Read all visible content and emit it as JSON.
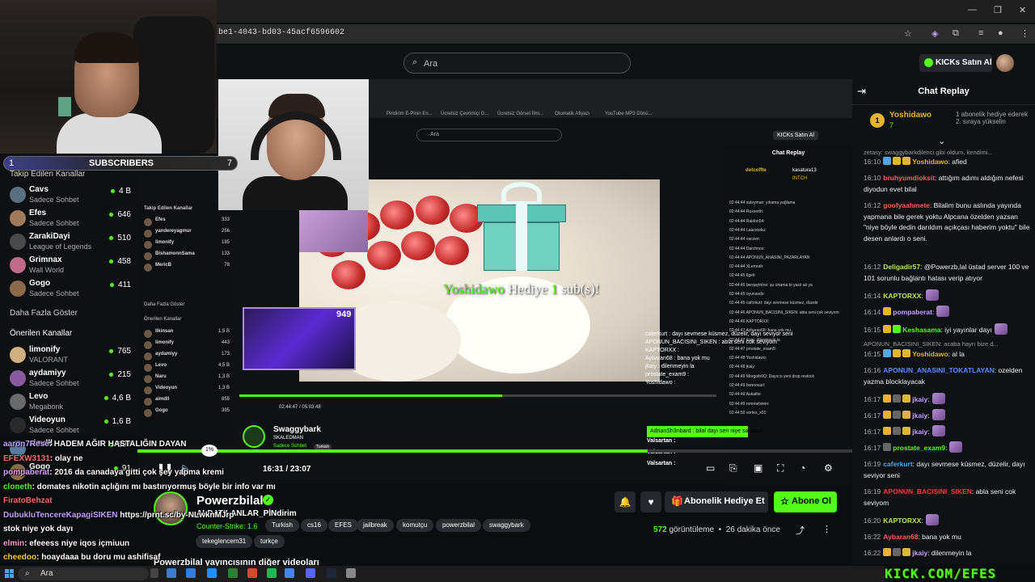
{
  "browser": {
    "url": "be1-4043-bd03-45acf6596602",
    "window_minimize": "—",
    "window_restore": "❐",
    "window_close": "✕"
  },
  "header": {
    "search_placeholder": "Ara",
    "kick_buy_label": "KICKs Satın Al"
  },
  "subs_bar": {
    "left": "1",
    "label": "SUBSCRIBERS",
    "right": "7"
  },
  "sidebar": {
    "followed_title": "Takip Edilen Kanallar",
    "followed": [
      {
        "name": "Cavs",
        "sub": "Sadece Sohbet",
        "count": "4 B",
        "color": "#5a6f80"
      },
      {
        "name": "Efes",
        "sub": "Sadece Sohbet",
        "count": "646",
        "color": "#a07a5a"
      },
      {
        "name": "ZarakiDayi",
        "sub": "League of Legends",
        "count": "510",
        "color": "#4a4a4a"
      },
      {
        "name": "Grimnax",
        "sub": "Wall World",
        "count": "458",
        "color": "#c06a8a"
      },
      {
        "name": "Gogo",
        "sub": "Sadece Sohbet",
        "count": "411",
        "color": "#8a6a4a"
      }
    ],
    "show_more": "Daha Fazla Göster",
    "recommended_title": "Önerilen Kanallar",
    "recommended": [
      {
        "name": "limonify",
        "sub": "VALORANT",
        "count": "765",
        "color": "#d0b080"
      },
      {
        "name": "aydamiyy",
        "sub": "Sadece Sohbet",
        "count": "215",
        "color": "#8a5aa0"
      },
      {
        "name": "Levo",
        "sub": "Megabonk",
        "count": "4,6 B",
        "color": "#6a6a6a"
      },
      {
        "name": "Videoyun",
        "sub": "Sadece Sohbet",
        "count": "1,6 B",
        "color": "#2a2a2a"
      },
      {
        "name": "aimdll",
        "sub": "",
        "count": "507",
        "color": "#5a7aa0"
      },
      {
        "name": "Gogo",
        "sub": "",
        "count": "91",
        "color": "#8a6a4a"
      }
    ]
  },
  "inner_stream": {
    "tabs": [
      "Pindirim E-Pinin En...",
      "Ücretsiz Çevrimiçi G...",
      "Ücretsiz Görsel İlmi...",
      "Otomatik Afiyazı",
      "YouTube MP3 Dönü..."
    ],
    "search": "Ara",
    "kick_buy": "KICKs Satın Al",
    "chat_title": "Chat Replay",
    "pinned_name": "dotcoffte",
    "pinned_user2": "kasatura13",
    "pinned_user3": "INTCH",
    "sidebar_items": [
      {
        "name": "Efes",
        "count": "333"
      },
      {
        "name": "yandereyagmur",
        "count": "256"
      },
      {
        "name": "limonify",
        "count": "185"
      },
      {
        "name": "BishamonnSama",
        "count": "133"
      },
      {
        "name": "MericB",
        "count": "78"
      },
      {
        "name": "Ilkinsan",
        "count": "1,5 B"
      },
      {
        "name": "limonify",
        "count": "443"
      },
      {
        "name": "aydamiyy",
        "count": "173"
      },
      {
        "name": "Levo",
        "count": "4,5 B"
      },
      {
        "name": "Naru",
        "count": "1,3 B"
      },
      {
        "name": "Videoyun",
        "count": "1,3 B"
      },
      {
        "name": "aimdll",
        "count": "855"
      },
      {
        "name": "Gogo",
        "count": "395"
      }
    ],
    "sidebar_followed": "Takip Edilen Kanallar",
    "sidebar_more": "Daha Fazla Göster",
    "sidebar_recommended": "Önerilen Kanallar",
    "alert_user": "Yoshidawo",
    "alert_mid": "Hediye",
    "alert_num": "1",
    "alert_end": "sub(s)!",
    "cam_number": "949",
    "time": "02:44:47 / 05:03:48",
    "streamer": "Swaggybark",
    "streamer_title": "SKALEDMAN",
    "streamer_cat": "Sadece Sohbet",
    "streamer_tag": "Turkish",
    "chat_lines": [
      "02:44:44 suleyman: yıkama yağlama",
      "02:44:44 Ruxxerth:",
      "02:44:44 Raidon54:",
      "02:44:44 Laacrooku:",
      "02:44:44 vaczen:",
      "02:44:44 Darchnox:",
      "02:44:44 APONUN_ANASINI_PAZARLAYAN",
      "02:44:44 XLemrah:",
      "02:44:45 Ilgeli:",
      "02:44:45 berqaytntno: şu ortama bi yasir alı ya",
      "02:44:45 oyunasde:",
      "02:44:45 cafcrkurt: dayı sevmese küsmez, düzelir",
      "02:44:46 APONUN_BACISINI_SIKEN: abla seni cok seviyom",
      "02:44:46 KAPTORXX:",
      "02:44:47 Aybaran68: bana yok mu",
      "02:44:47 jkaiy: dilenmeyin la",
      "02:44:47 prostate_exam9:",
      "02:44:48 Yoshidawo:",
      "02:44:48 jkaiy:",
      "02:44:49 Morgoth0Q: Dayıcıo yeni drop restock",
      "02:44:49 bonnovarl:",
      "02:44:49 Aukatlio:",
      "02:44:49 rommelstein:",
      "02:44:50 vortex_x01:"
    ],
    "overlay_chat": [
      "caferkurt : dayı sevmese küsmez, düzelir, dayı seviyor seni",
      "APONUN_BACISINI_SIKEN : abla seni cok seviyom",
      "KAPTORXX :",
      "Aybaran68 : bana yok mu",
      "jkaiy : dilenmeyin la",
      "prostate_exam9 :",
      "Yoshidawo :"
    ],
    "green_strip": "AdrianSh3nbard : bilal dayı sen niye sakaları",
    "valsartan": [
      "Valsartan :",
      "Valsartan :",
      "Valsartan :"
    ]
  },
  "player": {
    "time": "16:31 / 23:07",
    "volume_badge": "1%",
    "progress_fraction": 0.714
  },
  "stream": {
    "streamer": "Powerzbilal",
    "title": "ALDATILANLAR_PİNdirim",
    "category": "Counter-Strike: 1.6",
    "tags": [
      "Turkish",
      "cs16",
      "EFES",
      "jailbreak",
      "komutçu",
      "powerzbilal",
      "swaggybark",
      "tekeglencem31",
      "turkçe"
    ],
    "gift_label": "Abonelik Hediye Et",
    "sub_label": "Abone Ol",
    "views_count": "572",
    "views_label": "görüntüleme",
    "time_ago": "26 dakika önce",
    "more_videos": "Powerzbilal yayıncısının diğer videoları"
  },
  "overlay_chat": [
    {
      "user": "aaron7Rese",
      "text": ": HADEM AĞIR HASTALIĞIN DAYAN",
      "color": "#c6a0ff"
    },
    {
      "user": "EFEXW3131",
      "text": ": olay ne",
      "color": "#ff6b6b"
    },
    {
      "user": "pompaberat",
      "text": ": 2016 da canadaya gitti çok şey yapma kremi",
      "color": "#e0a0ff"
    },
    {
      "user": "cloneth",
      "text": ": domates nikotin açlığını mı bastırıyormuş böyle bir info var mı",
      "color": "#53fc18"
    },
    {
      "user": "FiratoBehzat",
      "text": "",
      "color": "#ff6b6b"
    },
    {
      "user": "DubukluTencereKapagiSIKEN",
      "text": " https://prnt.sc/by-NLwknMJrp",
      "color": "#c6a0ff"
    },
    {
      "user": "stok niye yok dayı",
      "text": "",
      "color": "#ffffff"
    },
    {
      "user": "elmin",
      "text": ": efeeess niye iqos içmiuun",
      "color": "#ff9ad5"
    },
    {
      "user": "cheedoo",
      "text": ": hoaydaaa bu doru mu ashifisaf",
      "color": "#ffcc33"
    }
  ],
  "chat": {
    "title": "Chat Replay",
    "pinned_user": "Yoshidawo",
    "pinned_count": "7",
    "pinned_badge": "1",
    "pinned_text": "1 abonelik hediye ederek 2. sıraya yükselin",
    "reply_1": "zetasy: swaggybarkdilenci gibi oldum, kendimi...",
    "reply_2": "APONUN_BACISINI_SIKEN: acaba hayrı bize d...",
    "messages": [
      {
        "time": "16:10",
        "user": "Yoshidawo",
        "text": ": afied",
        "color": "#e6b428",
        "badges": [
          "#53a6e6",
          "#e6b428",
          "#e6b428"
        ],
        "emote": false
      },
      {
        "time": "16:10",
        "user": "bruhyumdioksit",
        "text": ": attığım adımı aldığım nefesi diyodun evet bilal",
        "color": "#ff5c5c",
        "badges": [],
        "emote": false
      },
      {
        "time": "16:12",
        "user": "goofyaahmete",
        "text": ": Bilalim bunu aslında yayında yapmana bile gerek yoktu Alpcana özelden yazsan \"niye böyle dedin darıldım açıkçası haberim yoktu\" bile desen anlardı o seni.",
        "color": "#ff5c5c",
        "badges": [],
        "emote": false
      },
      {
        "time": "16:12",
        "user": "Deligadir57",
        "text": ": @Powerzb,lal üstad server 100 ve 101 sorunlu bağlantı hatası verip atıyor",
        "color": "#b9e65c",
        "badges": [],
        "emote": false
      },
      {
        "time": "16:14",
        "user": "KAPTORXX",
        "text": ":",
        "color": "#b9e65c",
        "badges": [],
        "emote": true
      },
      {
        "time": "16:14",
        "user": "pompaberat",
        "text": ":",
        "color": "#c6a0ff",
        "badges": [
          "#e6b428"
        ],
        "emote": true
      },
      {
        "time": "16:15",
        "user": "Keshasama",
        "text": ": iyi yayınlar dayı",
        "color": "#53fc18",
        "badges": [
          "#e6b428",
          "#53fc18"
        ],
        "emote": true
      },
      {
        "time": "16:15",
        "user": "Yoshidawo",
        "text": ": al la",
        "color": "#e6b428",
        "badges": [
          "#53a6e6",
          "#e6b428",
          "#e6b428"
        ],
        "emote": false
      },
      {
        "time": "16:16",
        "user": "APONUN_ANASINI_TOKATLAYAN",
        "text": ": ozelden yazma blocklayacak",
        "color": "#5c8cff",
        "badges": [],
        "emote": false
      },
      {
        "time": "16:17",
        "user": "jkaiy",
        "text": ":",
        "color": "#c6a0ff",
        "badges": [
          "#e6b428",
          "#666",
          "#e6b428"
        ],
        "emote": true
      },
      {
        "time": "16:17",
        "user": "jkaiy",
        "text": ":",
        "color": "#c6a0ff",
        "badges": [
          "#e6b428",
          "#666",
          "#e6b428"
        ],
        "emote": true
      },
      {
        "time": "16:17",
        "user": "jkaiy",
        "text": ":",
        "color": "#c6a0ff",
        "badges": [
          "#e6b428",
          "#666",
          "#e6b428"
        ],
        "emote": true
      },
      {
        "time": "16:17",
        "user": "prostate_exam9",
        "text": ":",
        "color": "#53fc18",
        "badges": [
          "#666"
        ],
        "emote": true
      },
      {
        "time": "16:19",
        "user": "caferkurt",
        "text": ": dayı sevmese küsmez, düzelir, dayı seviyor seni",
        "color": "#53a6e6",
        "badges": [],
        "emote": false
      },
      {
        "time": "16:19",
        "user": "APONUN_BACISINI_SIKEN",
        "text": ": abla seni cok seviyom",
        "color": "#ff3b3b",
        "badges": [],
        "emote": false
      },
      {
        "time": "16:20",
        "user": "KAPTORXX",
        "text": ":",
        "color": "#b9e65c",
        "badges": [],
        "emote": true
      },
      {
        "time": "16:22",
        "user": "Aybaran68",
        "text": ": bana yok mu",
        "color": "#ff5c5c",
        "badges": [],
        "emote": false
      },
      {
        "time": "16:22",
        "user": "jkaiy",
        "text": ": dilenmeyin la",
        "color": "#c6a0ff",
        "badges": [
          "#e6b428",
          "#666",
          "#e6b428"
        ],
        "emote": false
      }
    ]
  },
  "watermark": "KICK.COM/EFES",
  "taskbar": {
    "search": "Ara"
  },
  "colors": {
    "kick_green": "#53fc18",
    "bg": "#0b0e0f",
    "panel": "#0f1214"
  }
}
